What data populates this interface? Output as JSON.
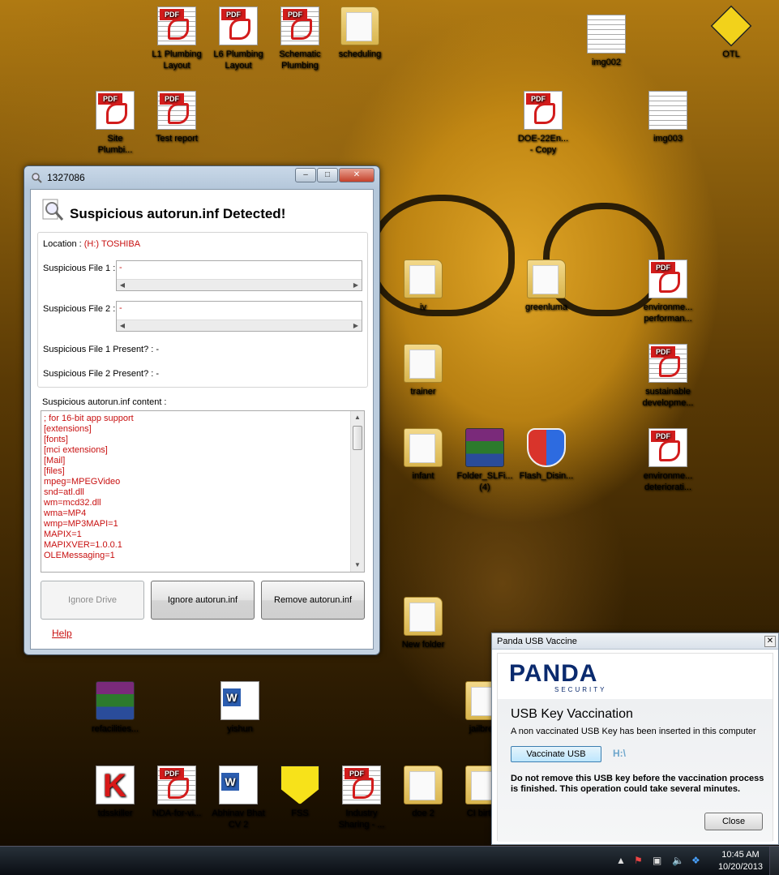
{
  "desktop": {
    "icons": [
      {
        "label": "L1 Plumbing\nLayout",
        "type": "doc-pdf"
      },
      {
        "label": "L6 Plumbing\nLayout",
        "type": "pdf"
      },
      {
        "label": "Schematic\nPlumbing",
        "type": "doc-pdf"
      },
      {
        "label": "scheduling",
        "type": "folder"
      },
      {
        "label": "img002",
        "type": "doc"
      },
      {
        "label": "OTL",
        "type": "otl"
      },
      {
        "label": "Site\nPlumbi...",
        "type": "pdf"
      },
      {
        "label": "Test report",
        "type": "doc-pdf"
      },
      {
        "label": "DOE-22En...\n- Copy",
        "type": "pdf"
      },
      {
        "label": "img003",
        "type": "doc"
      },
      {
        "label": "iv",
        "type": "folder"
      },
      {
        "label": "greenluma",
        "type": "folder"
      },
      {
        "label": "environme...\nperforman...",
        "type": "pdf"
      },
      {
        "label": "trainer",
        "type": "folder"
      },
      {
        "label": "sustainable\ndevelopme...",
        "type": "doc-pdf"
      },
      {
        "label": "infant",
        "type": "folder"
      },
      {
        "label": "Folder_SLFi...\n(4)",
        "type": "rar"
      },
      {
        "label": "Flash_Disin...",
        "type": "shield"
      },
      {
        "label": "environme...\ndeteriorati...",
        "type": "pdf"
      },
      {
        "label": "New folder",
        "type": "folder"
      },
      {
        "label": "refacilities...",
        "type": "rar"
      },
      {
        "label": "yishun",
        "type": "word"
      },
      {
        "label": "jailbre...",
        "type": "folder"
      },
      {
        "label": "tdsskiller",
        "type": "kav"
      },
      {
        "label": "NDA-for-vi...",
        "type": "doc-pdf"
      },
      {
        "label": "Abhinav Bhat\nCV 2",
        "type": "word"
      },
      {
        "label": "FSS",
        "type": "fss"
      },
      {
        "label": "Industry\nSharing - ...",
        "type": "doc-pdf"
      },
      {
        "label": "doe 2",
        "type": "folder"
      },
      {
        "label": "CI birth...",
        "type": "folder"
      }
    ]
  },
  "autorun_window": {
    "title": "1327086",
    "heading": "Suspicious autorun.inf Detected!",
    "location_label": "Location :",
    "location_value": "(H:) TOSHIBA",
    "file1_label": "Suspicious File 1 :",
    "file1_value": "-",
    "file2_label": "Suspicious File 2 :",
    "file2_value": "-",
    "file1_present_label": "Suspicious File 1 Present? :",
    "file1_present_value": "-",
    "file2_present_label": "Suspicious File 2 Present? :",
    "file2_present_value": "-",
    "content_label": "Suspicious autorun.inf content :",
    "content_lines": [
      "; for 16-bit app support",
      "[extensions]",
      "[fonts]",
      "[mci extensions]",
      "[Mail]",
      "[files]",
      "mpeg=MPEGVideo",
      "snd=atl.dll",
      "wm=mcd32.dll",
      "wma=MP4",
      "wmp=MP3MAPI=1",
      "MAPIX=1",
      "MAPIXVER=1.0.0.1",
      "OLEMessaging=1"
    ],
    "btn_ignore_drive": "Ignore Drive",
    "btn_ignore_autorun": "Ignore autorun.inf",
    "btn_remove_autorun": "Remove autorun.inf",
    "help": "Help"
  },
  "panda_window": {
    "title": "Panda USB Vaccine",
    "logo": "PANDA",
    "logo_sub": "SECURITY",
    "heading": "USB Key Vaccination",
    "note": "A non vaccinated USB Key has been inserted in this computer",
    "vaccinate_btn": "Vaccinate USB",
    "drive": "H:\\",
    "warning": "Do not remove this USB key before the vaccination process is finished. This operation could take several minutes.",
    "close_btn": "Close"
  },
  "taskbar": {
    "time": "10:45 AM",
    "date": "10/20/2013"
  },
  "colors": {
    "accent_red": "#c81010",
    "panda_blue": "#0a2a6e"
  }
}
